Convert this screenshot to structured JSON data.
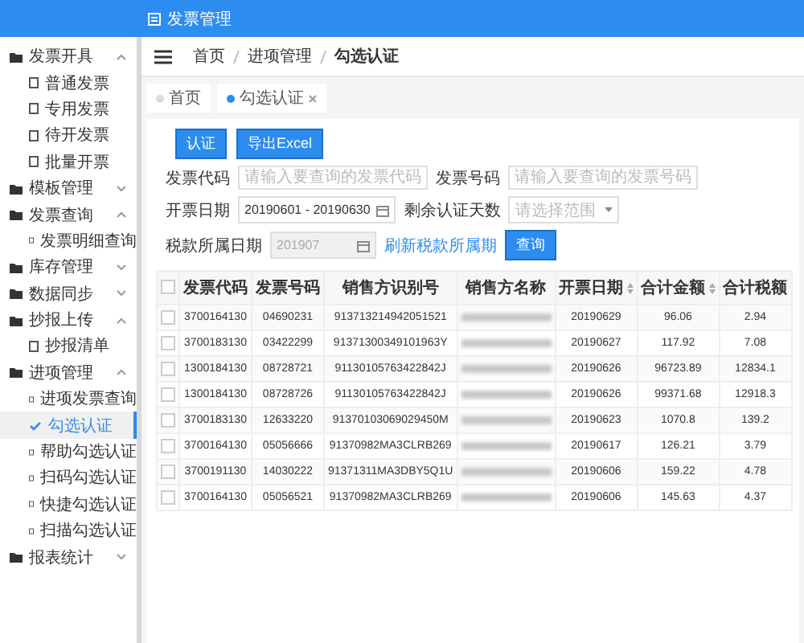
{
  "header": {
    "title": "发票管理"
  },
  "sidebar": {
    "groups": [
      {
        "label": "发票开具",
        "expanded": true,
        "children": [
          {
            "label": "普通发票",
            "selected": false
          },
          {
            "label": "专用发票",
            "selected": false
          },
          {
            "label": "待开发票",
            "selected": false
          },
          {
            "label": "批量开票",
            "selected": false
          }
        ]
      },
      {
        "label": "模板管理",
        "expanded": false
      },
      {
        "label": "发票查询",
        "expanded": true,
        "children": [
          {
            "label": "发票明细查询",
            "selected": false
          }
        ]
      },
      {
        "label": "库存管理",
        "expanded": false
      },
      {
        "label": "数据同步",
        "expanded": false
      },
      {
        "label": "抄报上传",
        "expanded": true,
        "children": [
          {
            "label": "抄报清单",
            "selected": false
          }
        ]
      },
      {
        "label": "进项管理",
        "expanded": true,
        "children": [
          {
            "label": "进项发票查询",
            "selected": false
          },
          {
            "label": "勾选认证",
            "selected": true
          },
          {
            "label": "帮助勾选认证",
            "selected": false
          },
          {
            "label": "扫码勾选认证",
            "selected": false
          },
          {
            "label": "快捷勾选认证",
            "selected": false
          },
          {
            "label": "扫描勾选认证",
            "selected": false
          }
        ]
      },
      {
        "label": "报表统计",
        "expanded": false
      }
    ]
  },
  "breadcrumb": [
    "首页",
    "进项管理",
    "勾选认证"
  ],
  "tabs": [
    {
      "label": "首页",
      "selected": false,
      "closable": false
    },
    {
      "label": "勾选认证",
      "selected": true,
      "closable": true
    }
  ],
  "actions": [
    "认证",
    "导出Excel"
  ],
  "filters": {
    "invoice_code": {
      "label": "发票代码",
      "placeholder": "请输入要查询的发票代码"
    },
    "invoice_number": {
      "label": "发票号码",
      "placeholder": "请输入要查询的发票号码"
    },
    "issue_date": {
      "label": "开票日期",
      "value": "20190601 - 20190630"
    },
    "remaining_days": {
      "label": "剩余认证天数",
      "placeholder": "请选择范围"
    },
    "tax_period": {
      "label": "税款所属日期",
      "value": "201907",
      "disabled": true
    },
    "refresh_link": "刷新税款所属期",
    "search_button": "查询"
  },
  "table": {
    "columns": [
      {
        "label": "发票代码",
        "sortable": false
      },
      {
        "label": "发票号码",
        "sortable": false
      },
      {
        "label": "销售方识别号",
        "sortable": false
      },
      {
        "label": "销售方名称",
        "sortable": false
      },
      {
        "label": "开票日期",
        "sortable": true
      },
      {
        "label": "合计金额",
        "sortable": true
      },
      {
        "label": "合计税额",
        "sortable": false
      }
    ],
    "header_checked": false,
    "rows": [
      {
        "checked": false,
        "cells": [
          "3700164130",
          "04690231",
          "913713214942051521",
          "",
          "20190629",
          "96.06",
          "2.94"
        ]
      },
      {
        "checked": false,
        "cells": [
          "3700183130",
          "03422299",
          "91371300349101963Y",
          "",
          "20190627",
          "117.92",
          "7.08"
        ]
      },
      {
        "checked": false,
        "cells": [
          "1300184130",
          "08728721",
          "91130105763422842J",
          "",
          "20190626",
          "96723.89",
          "12834.1"
        ]
      },
      {
        "checked": false,
        "cells": [
          "1300184130",
          "08728726",
          "91130105763422842J",
          "",
          "20190626",
          "99371.68",
          "12918.3"
        ]
      },
      {
        "checked": false,
        "cells": [
          "3700183130",
          "12633220",
          "91370103069029450M",
          "",
          "20190623",
          "1070.8",
          "139.2"
        ]
      },
      {
        "checked": false,
        "cells": [
          "3700164130",
          "05056666",
          "91370982MA3CLRB269",
          "",
          "20190617",
          "126.21",
          "3.79"
        ]
      },
      {
        "checked": false,
        "cells": [
          "3700191130",
          "14030222",
          "91371311MA3DBY5Q1U",
          "",
          "20190606",
          "159.22",
          "4.78"
        ]
      },
      {
        "checked": false,
        "cells": [
          "3700164130",
          "05056521",
          "91370982MA3CLRB269",
          "",
          "20190606",
          "145.63",
          "4.37"
        ]
      }
    ]
  }
}
